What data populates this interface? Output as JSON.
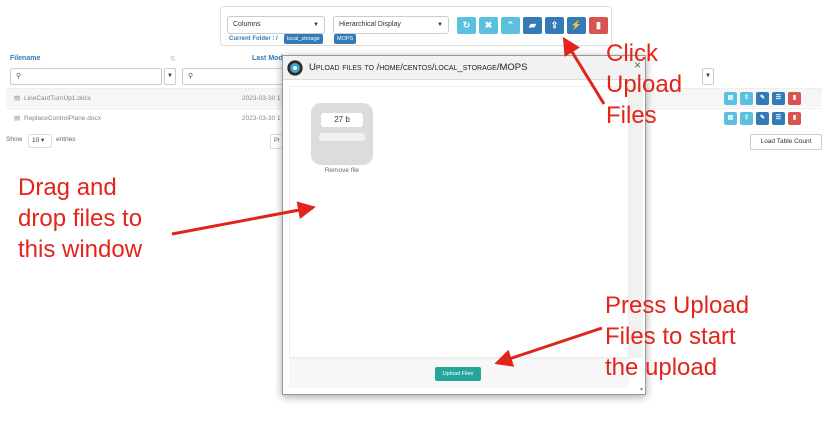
{
  "toolbar": {
    "columns_select": "Columns",
    "display_select": "Hierarchical Display",
    "buttons": [
      {
        "icon": "refresh-icon",
        "glyph": "↻"
      },
      {
        "icon": "close-icon",
        "glyph": "✖"
      },
      {
        "icon": "chevron-up-icon",
        "glyph": "⌃"
      },
      {
        "icon": "folder-open-icon",
        "glyph": "▰"
      },
      {
        "icon": "upload-icon",
        "glyph": "⇪"
      },
      {
        "icon": "bolt-icon",
        "glyph": "⚡"
      },
      {
        "icon": "trash-icon",
        "glyph": "▮"
      }
    ],
    "current_folder_label": "Current Folder : /",
    "crumbs": [
      "local_storage",
      "MOPS"
    ]
  },
  "table": {
    "headers": [
      "Filename",
      "Last Mod"
    ],
    "search_glyph": "🔍",
    "rows": [
      {
        "filename": "LineCardTurnUp1.docx",
        "modified": "2023-03-30 1"
      },
      {
        "filename": "ReplaceControlPlane.docx",
        "modified": "2023-03-30 1"
      }
    ],
    "show_label": "Show",
    "show_value": "10",
    "entries_label": "entries",
    "pager_label": "Pr",
    "load_table_count": "Load Table Count"
  },
  "modal": {
    "title": "Upload files to /home/centos/local_storage/MOPS",
    "file_size": "27 b",
    "remove_file": "Remove file",
    "upload_button": "Upload Files"
  },
  "annotations": {
    "click_upload": "Click\nUpload\nFiles",
    "drag_drop": "Drag and\ndrop files to\nthis window",
    "press_upload": "Press Upload\nFiles to start\nthe upload"
  },
  "colors": {
    "annotation": "#e2241a",
    "primary": "#337ab7",
    "info": "#5bc0de",
    "danger": "#d9534f",
    "upload_green": "#26a69a"
  }
}
